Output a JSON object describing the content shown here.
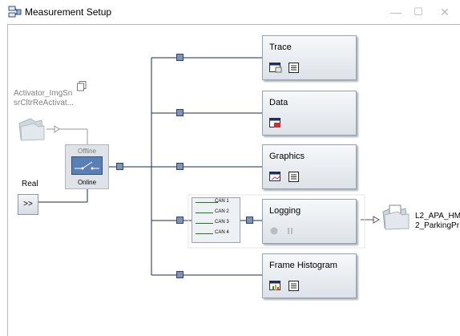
{
  "window": {
    "title": "Measurement Setup",
    "title_icon": "measurement-setup-icon"
  },
  "controls": {
    "minimize": "—",
    "maximize": "☐",
    "close": "✕"
  },
  "sources": {
    "activator": {
      "line1": "Activator_ImgSn",
      "line2": "srCltrReActivat..."
    },
    "real": {
      "label": "Real",
      "button": ">>"
    }
  },
  "switch": {
    "offline": "Offline",
    "online": "Online"
  },
  "blocks": {
    "trace": {
      "label": "Trace"
    },
    "data": {
      "label": "Data"
    },
    "graphics": {
      "label": "Graphics"
    },
    "logging": {
      "label": "Logging"
    },
    "histogram": {
      "label": "Frame Histogram"
    }
  },
  "can_filter": [
    "CAN 1",
    "CAN 2",
    "CAN 3",
    "CAN 4"
  ],
  "log_file": {
    "line1": "L2_APA_HM",
    "line2": "2_ParkingPr"
  },
  "colors": {
    "node_fill": "#7f93b6",
    "wire": "#1a2a52",
    "can_line": "#1f7a1f"
  }
}
